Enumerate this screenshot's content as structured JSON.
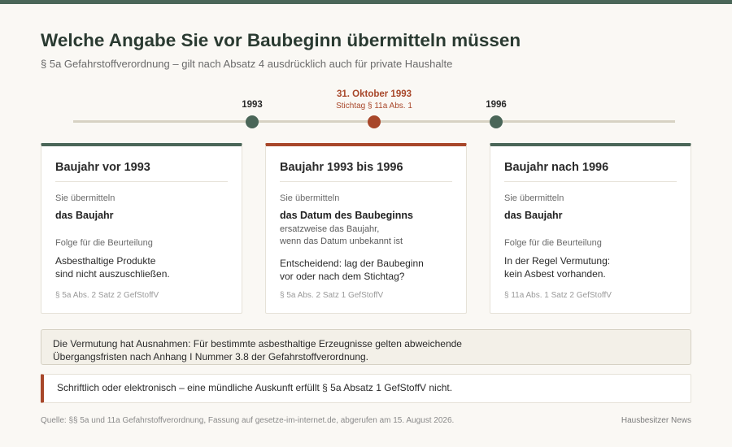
{
  "header": {
    "title": "Welche Angabe Sie vor Baubeginn übermitteln müssen",
    "subtitle": "§ 5a Gefahrstoffverordnung – gilt nach Absatz 4 ausdrücklich auch für private Haushalte"
  },
  "timeline": {
    "markers": [
      {
        "label": "1993",
        "sub": ""
      },
      {
        "label": "31. Oktober 1993",
        "sub": "Stichtag § 11a Abs. 1"
      },
      {
        "label": "1996",
        "sub": ""
      }
    ]
  },
  "cards": [
    {
      "title": "Baujahr vor 1993",
      "submit_label": "Sie übermitteln",
      "submit_value": "das Baujahr",
      "alt_line1": "",
      "alt_line2": "",
      "consequence_label": "Folge für die Beurteilung",
      "consequence_line1": "Asbesthaltige Produkte",
      "consequence_line2": "sind nicht auszuschließen.",
      "reference": "§ 5a Abs. 2 Satz 2 GefStoffV"
    },
    {
      "title": "Baujahr 1993 bis 1996",
      "submit_label": "Sie übermitteln",
      "submit_value": "das Datum des Baubeginns",
      "alt_line1": "ersatzweise das Baujahr,",
      "alt_line2": "wenn das Datum unbekannt ist",
      "consequence_label": "",
      "consequence_line1": "Entscheidend: lag der Baubeginn",
      "consequence_line2": "vor oder nach dem Stichtag?",
      "reference": "§ 5a Abs. 2 Satz 1 GefStoffV"
    },
    {
      "title": "Baujahr nach 1996",
      "submit_label": "Sie übermitteln",
      "submit_value": "das Baujahr",
      "alt_line1": "",
      "alt_line2": "",
      "consequence_label": "Folge für die Beurteilung",
      "consequence_line1": "In der Regel Vermutung:",
      "consequence_line2": "kein Asbest vorhanden.",
      "reference": "§ 11a Abs. 1 Satz 2 GefStoffV"
    }
  ],
  "note": {
    "line1": "Die Vermutung hat Ausnahmen: Für bestimmte asbesthaltige Erzeugnisse gelten abweichende",
    "line2": "Übergangsfristen nach Anhang I Nummer 3.8 der Gefahrstoffverordnung."
  },
  "warning": "Schriftlich oder elektronisch – eine mündliche Auskunft erfüllt § 5a Absatz 1 GefStoffV nicht.",
  "footer": {
    "source": "Quelle: §§ 5a und 11a Gefahrstoffverordnung, Fassung auf gesetze-im-internet.de, abgerufen am 15. August 2026.",
    "brand": "Hausbesitzer News"
  },
  "colors": {
    "primary": "#4a6658",
    "accent": "#a8472a",
    "background": "#faf8f4"
  }
}
